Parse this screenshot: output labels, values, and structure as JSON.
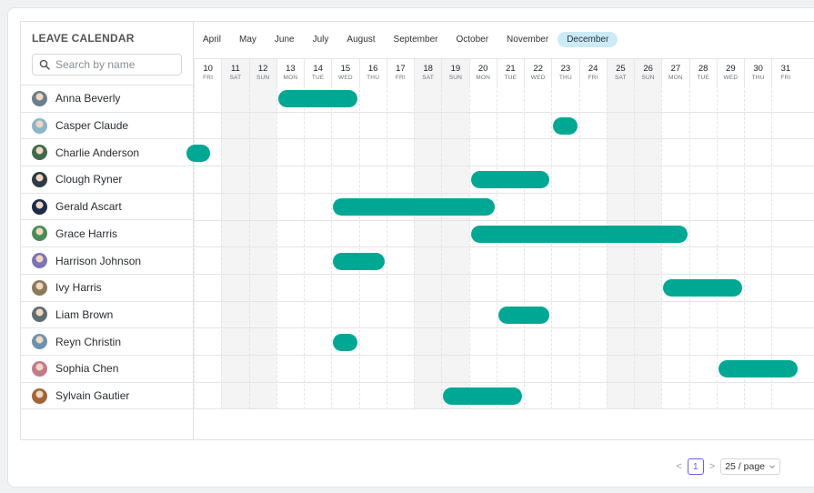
{
  "title": "LEAVE CALENDAR",
  "search": {
    "placeholder": "Search by name"
  },
  "months": [
    "April",
    "May",
    "June",
    "July",
    "August",
    "September",
    "October",
    "November",
    "December"
  ],
  "active_month": "December",
  "days": [
    {
      "d": "10",
      "w": "FRI"
    },
    {
      "d": "11",
      "w": "SAT"
    },
    {
      "d": "12",
      "w": "SUN"
    },
    {
      "d": "13",
      "w": "MON"
    },
    {
      "d": "14",
      "w": "TUE"
    },
    {
      "d": "15",
      "w": "WED"
    },
    {
      "d": "16",
      "w": "THU"
    },
    {
      "d": "17",
      "w": "FRI"
    },
    {
      "d": "18",
      "w": "SAT"
    },
    {
      "d": "19",
      "w": "SUN"
    },
    {
      "d": "20",
      "w": "MON"
    },
    {
      "d": "21",
      "w": "TUE"
    },
    {
      "d": "22",
      "w": "WED"
    },
    {
      "d": "23",
      "w": "THU"
    },
    {
      "d": "24",
      "w": "FRI"
    },
    {
      "d": "25",
      "w": "SAT"
    },
    {
      "d": "26",
      "w": "SUN"
    },
    {
      "d": "27",
      "w": "MON"
    },
    {
      "d": "28",
      "w": "TUE"
    },
    {
      "d": "29",
      "w": "WED"
    },
    {
      "d": "30",
      "w": "THU"
    },
    {
      "d": "31",
      "w": "FRI"
    }
  ],
  "employees": [
    {
      "name": "Anna Beverly",
      "avatar": "#6b7f8c",
      "leave": [
        13,
        15
      ]
    },
    {
      "name": "Casper Claude",
      "avatar": "#8bb6c9",
      "leave": [
        23,
        23
      ]
    },
    {
      "name": "Charlie Anderson",
      "avatar": "#3f6b4a",
      "leave": [
        10,
        10
      ]
    },
    {
      "name": "Clough Ryner",
      "avatar": "#2e3a44",
      "leave": [
        20,
        22
      ]
    },
    {
      "name": "Gerald Ascart",
      "avatar": "#1c2c4a",
      "leave": [
        15,
        20
      ]
    },
    {
      "name": "Grace Harris",
      "avatar": "#4a8d54",
      "leave": [
        20,
        27
      ]
    },
    {
      "name": "Harrison Johnson",
      "avatar": "#7c74b8",
      "leave": [
        15,
        16
      ]
    },
    {
      "name": "Ivy Harris",
      "avatar": "#8c7a5c",
      "leave": [
        27,
        29
      ]
    },
    {
      "name": "Liam Brown",
      "avatar": "#5c6e73",
      "leave": [
        21,
        22
      ]
    },
    {
      "name": "Reyn Christin",
      "avatar": "#6d92b0",
      "leave": [
        15,
        15
      ]
    },
    {
      "name": "Sophia Chen",
      "avatar": "#c27b8a",
      "leave": [
        29,
        31
      ]
    },
    {
      "name": "Sylvain Gautier",
      "avatar": "#a0663a",
      "leave": [
        19,
        21
      ]
    }
  ],
  "pagination": {
    "prev": "<",
    "page": "1",
    "next": ">",
    "page_size": "25 / page"
  },
  "colors": {
    "leave_bar": "#00a894",
    "active_month_bg": "#cdeaf7"
  }
}
